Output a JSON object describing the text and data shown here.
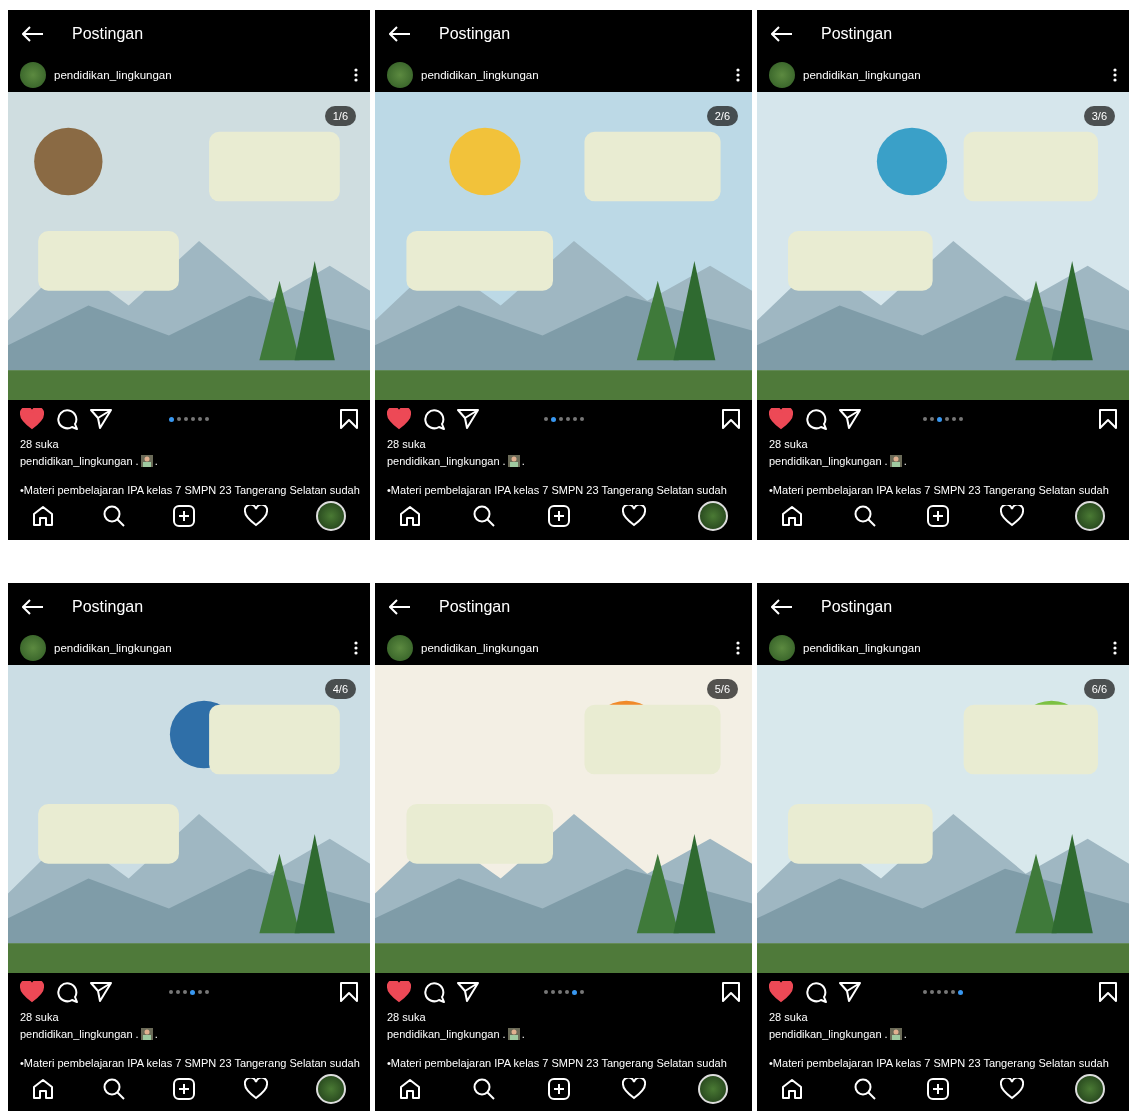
{
  "posts": [
    {
      "header_title": "Postingan",
      "username": "pendidikan_lingkungan",
      "counter": "1/6",
      "liked": true,
      "dots": [
        {
          "selected": true
        },
        {
          "selected": false
        },
        {
          "selected": false
        },
        {
          "selected": false
        },
        {
          "selected": false
        },
        {
          "selected": false
        }
      ],
      "likes": "28 suka",
      "caption_author": "pendidikan_lingkungan .",
      "caption_end": ".",
      "caption": "•Materi pembelajaran IPA kelas 7 SMPN 23 Tangerang Selatan sudah"
    },
    {
      "header_title": "Postingan",
      "username": "pendidikan_lingkungan",
      "counter": "2/6",
      "liked": true,
      "dots": [
        {
          "selected": false
        },
        {
          "selected": true
        },
        {
          "selected": false
        },
        {
          "selected": false
        },
        {
          "selected": false
        },
        {
          "selected": false
        }
      ],
      "likes": "28 suka",
      "caption_author": "pendidikan_lingkungan .",
      "caption_end": ".",
      "caption": "•Materi pembelajaran IPA kelas 7 SMPN 23 Tangerang Selatan sudah"
    },
    {
      "header_title": "Postingan",
      "username": "pendidikan_lingkungan",
      "counter": "3/6",
      "liked": true,
      "dots": [
        {
          "selected": false
        },
        {
          "selected": false
        },
        {
          "selected": true
        },
        {
          "selected": false
        },
        {
          "selected": false
        },
        {
          "selected": false
        }
      ],
      "likes": "28 suka",
      "caption_author": "pendidikan_lingkungan .",
      "caption_end": ".",
      "caption": "•Materi pembelajaran IPA kelas 7 SMPN 23 Tangerang Selatan sudah"
    },
    {
      "header_title": "Postingan",
      "username": "pendidikan_lingkungan",
      "counter": "4/6",
      "liked": true,
      "dots": [
        {
          "selected": false
        },
        {
          "selected": false
        },
        {
          "selected": false
        },
        {
          "selected": true
        },
        {
          "selected": false
        },
        {
          "selected": false
        }
      ],
      "likes": "28 suka",
      "caption_author": "pendidikan_lingkungan .",
      "caption_end": ".",
      "caption": "•Materi pembelajaran IPA kelas 7 SMPN 23 Tangerang Selatan sudah"
    },
    {
      "header_title": "Postingan",
      "username": "pendidikan_lingkungan",
      "counter": "5/6",
      "liked": true,
      "dots": [
        {
          "selected": false
        },
        {
          "selected": false
        },
        {
          "selected": false
        },
        {
          "selected": false
        },
        {
          "selected": true
        },
        {
          "selected": false
        }
      ],
      "likes": "28 suka",
      "caption_author": "pendidikan_lingkungan .",
      "caption_end": ".",
      "caption": "•Materi pembelajaran IPA kelas 7 SMPN 23 Tangerang Selatan sudah"
    },
    {
      "header_title": "Postingan",
      "username": "pendidikan_lingkungan",
      "counter": "6/6",
      "liked": true,
      "dots": [
        {
          "selected": false
        },
        {
          "selected": false
        },
        {
          "selected": false
        },
        {
          "selected": false
        },
        {
          "selected": false
        },
        {
          "selected": true
        }
      ],
      "likes": "28 suka",
      "caption_author": "pendidikan_lingkungan .",
      "caption_end": ".",
      "caption": "•Materi pembelajaran IPA kelas 7 SMPN 23 Tangerang Selatan sudah"
    }
  ]
}
